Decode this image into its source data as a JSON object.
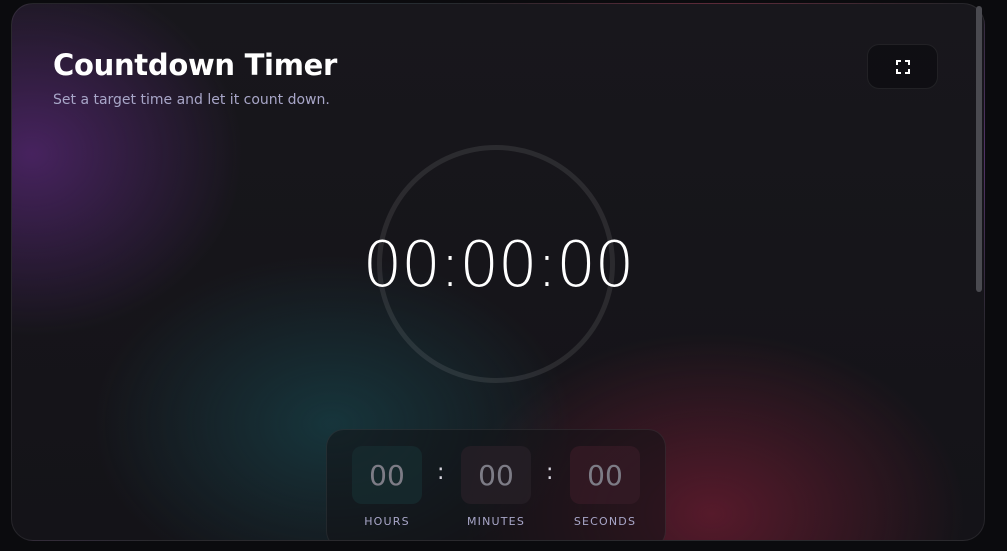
{
  "header": {
    "title": "Countdown Timer",
    "subtitle": "Set a target time and let it count down."
  },
  "toolbar": {
    "fullscreen_icon": "fullscreen-icon"
  },
  "timer": {
    "display": "00:00:00",
    "progress": 0
  },
  "inputs": {
    "hours": {
      "value": "",
      "placeholder": "00",
      "label": "HOURS"
    },
    "minutes": {
      "value": "",
      "placeholder": "00",
      "label": "MINUTES"
    },
    "seconds": {
      "value": "",
      "placeholder": "00",
      "label": "SECONDS"
    },
    "separator": ":"
  },
  "colors": {
    "title": "#ffffff",
    "subtitle": "#a8a6c8",
    "ring": "#2c2b32",
    "accent_purple": "#6e2d96",
    "accent_teal": "#185058",
    "accent_red": "#821e37"
  }
}
